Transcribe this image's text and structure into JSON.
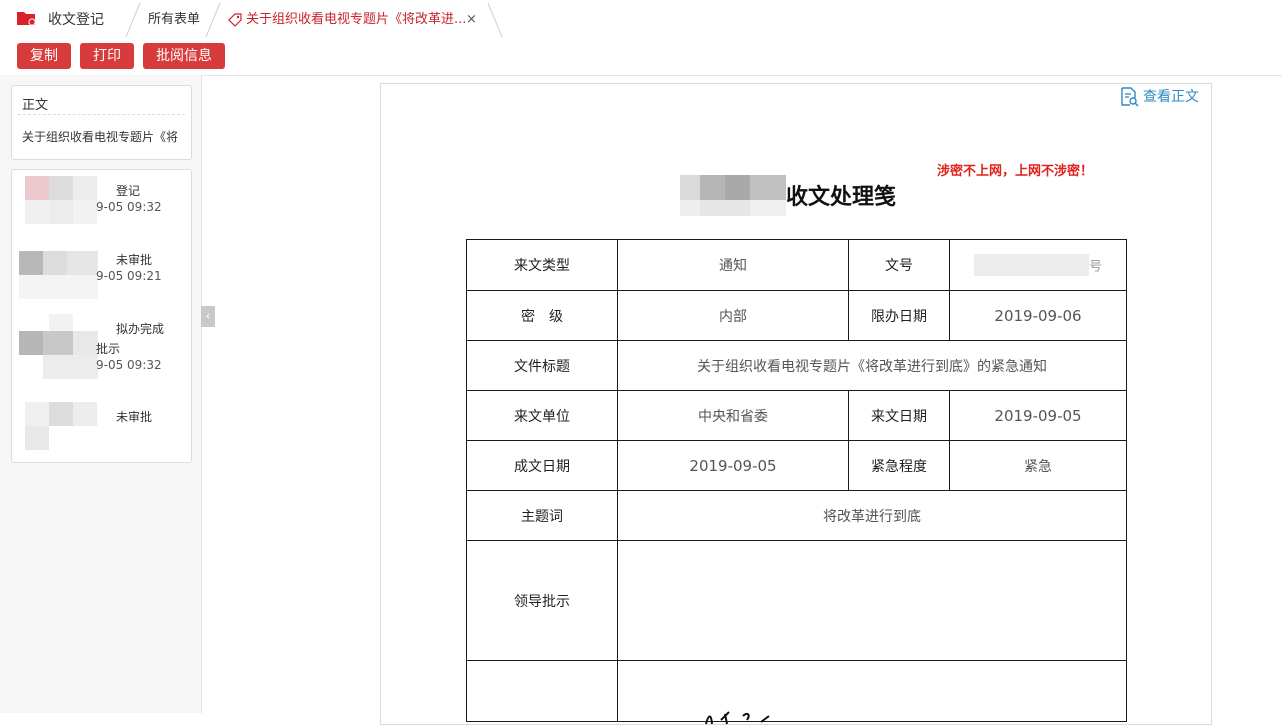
{
  "app": {
    "title": "收文登记",
    "tabs": [
      {
        "label": "所有表单"
      },
      {
        "label": "关于组织收看电视专题片《将改革进..."
      }
    ],
    "tab_close": "×"
  },
  "toolbar": {
    "copy": "复制",
    "print": "打印",
    "review_info": "批阅信息"
  },
  "left_panel": {
    "body_card": {
      "heading": "正文",
      "doc_link": "关于组织收看电视专题片《将"
    },
    "flow": [
      {
        "status": "登记",
        "time": "9-05 09:32"
      },
      {
        "status": "未审批",
        "time": "9-05 09:21"
      },
      {
        "status": "拟办完成",
        "extra": "批示",
        "time": "9-05 09:32"
      },
      {
        "status": "未审批"
      }
    ],
    "collapse_glyph": "‹"
  },
  "document": {
    "view_link": "查看正文",
    "secret_notice": "涉密不上网，上网不涉密！",
    "title": "收文处理笺",
    "rows": [
      {
        "label1": "来文类型",
        "value1": "通知",
        "label2": "文号",
        "value2_suffix": "号"
      },
      {
        "label1": "密　级",
        "value1": "内部",
        "label2": "限办日期",
        "value2": "2019-09-06"
      },
      {
        "label1": "文件标题",
        "value_span": "关于组织收看电视专题片《将改革进行到底》的紧急通知"
      },
      {
        "label1": "来文单位",
        "value1": "中央和省委",
        "label2": "来文日期",
        "value2": "2019-09-05"
      },
      {
        "label1": "成文日期",
        "value1": "2019-09-05",
        "label2": "紧急程度",
        "value2": "紧急"
      },
      {
        "label1": "主题词",
        "value_span": "将改革进行到底"
      },
      {
        "label1": "领导批示",
        "value_span": ""
      }
    ]
  },
  "colors": {
    "brand_red": "#d83b3b",
    "link_blue": "#2f8ac4",
    "notice_red": "#e0201b"
  }
}
